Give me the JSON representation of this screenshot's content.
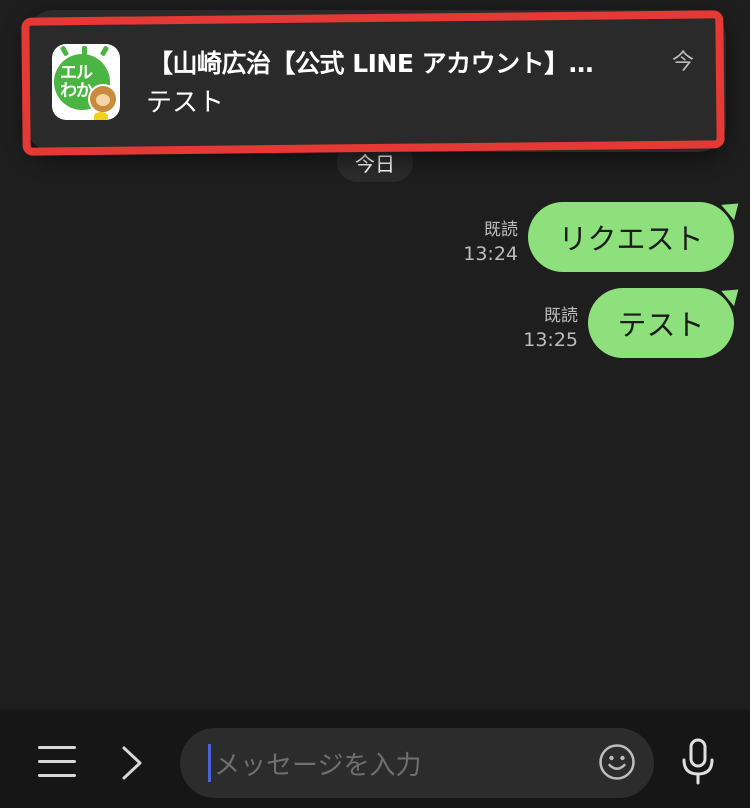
{
  "notification": {
    "app_icon_text_line1": "エル",
    "app_icon_text_line2": "わか",
    "title": "【山崎広治【公式 LINE アカウント】…",
    "time": "今",
    "body": "テスト"
  },
  "chat": {
    "date_separator": "今日",
    "messages": [
      {
        "text": "リクエスト",
        "read_label": "既読",
        "time": "13:24"
      },
      {
        "text": "テスト",
        "read_label": "既読",
        "time": "13:25"
      }
    ]
  },
  "input_bar": {
    "placeholder": "メッセージを入力"
  },
  "colors": {
    "background": "#1e1e1e",
    "bubble": "#8de07b",
    "highlight": "#e53935",
    "caret": "#4a63d6"
  },
  "icons": [
    "menu-icon",
    "chevron-right-icon",
    "smiley-icon",
    "microphone-icon",
    "app-icon"
  ]
}
